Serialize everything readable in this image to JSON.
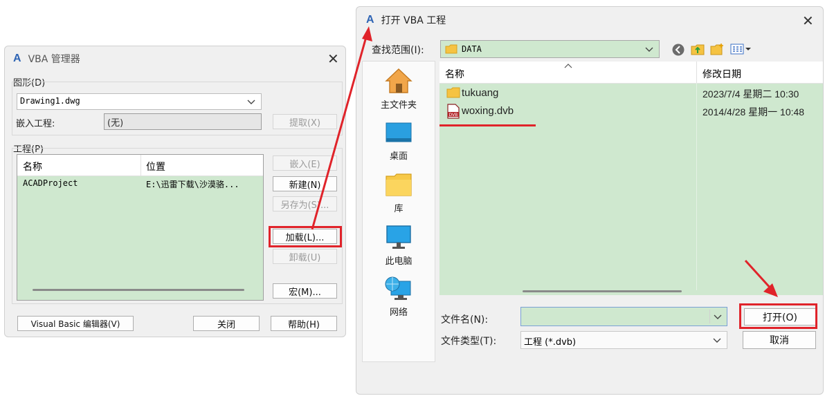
{
  "vba_manager": {
    "title": "VBA 管理器",
    "drawing_group_label": "图形(D)",
    "drawing_select_value": "Drawing1.dwg",
    "embedded_label": "嵌入工程:",
    "embedded_value": "(无)",
    "extract_button": "提取(X)",
    "project_group_label": "工程(P)",
    "columns": [
      "名称",
      "位置"
    ],
    "rows": [
      {
        "name": "ACADProject",
        "location": "E:\\迅雷下载\\沙漠骆..."
      }
    ],
    "embed_button": "嵌入(E)",
    "new_button": "新建(N)",
    "save_as_button": "另存为(S)...",
    "load_button": "加载(L)...",
    "unload_button": "卸载(U)",
    "macro_button": "宏(M)...",
    "vb_editor_button": "Visual Basic 编辑器(V)",
    "close_button": "关闭",
    "help_button": "帮助(H)"
  },
  "open_dialog": {
    "title": "打开 VBA 工程",
    "look_in_label": "查找范围(I):",
    "look_in_value": "DATA",
    "nav": [
      {
        "label": "主文件夹",
        "icon": "home-icon"
      },
      {
        "label": "桌面",
        "icon": "desktop-icon"
      },
      {
        "label": "库",
        "icon": "library-folder-icon"
      },
      {
        "label": "此电脑",
        "icon": "computer-icon"
      },
      {
        "label": "网络",
        "icon": "network-icon"
      }
    ],
    "col_name": "名称",
    "col_modified": "修改日期",
    "files": [
      {
        "name": "tukuang",
        "modified": "2023/7/4 星期二 10:30",
        "icon": "folder-icon"
      },
      {
        "name": "woxing.dvb",
        "modified": "2014/4/28 星期一 10:48",
        "icon": "dvb-file-icon"
      }
    ],
    "filename_label": "文件名(N):",
    "filename_value": "",
    "filetype_label": "文件类型(T):",
    "filetype_value": "工程 (*.dvb)",
    "open_button": "打开(O)",
    "cancel_button": "取消"
  },
  "colors": {
    "selection_green": "#cfe8cf",
    "annotation_red": "#e0232a",
    "dialog_bg": "#f0f0f0"
  }
}
